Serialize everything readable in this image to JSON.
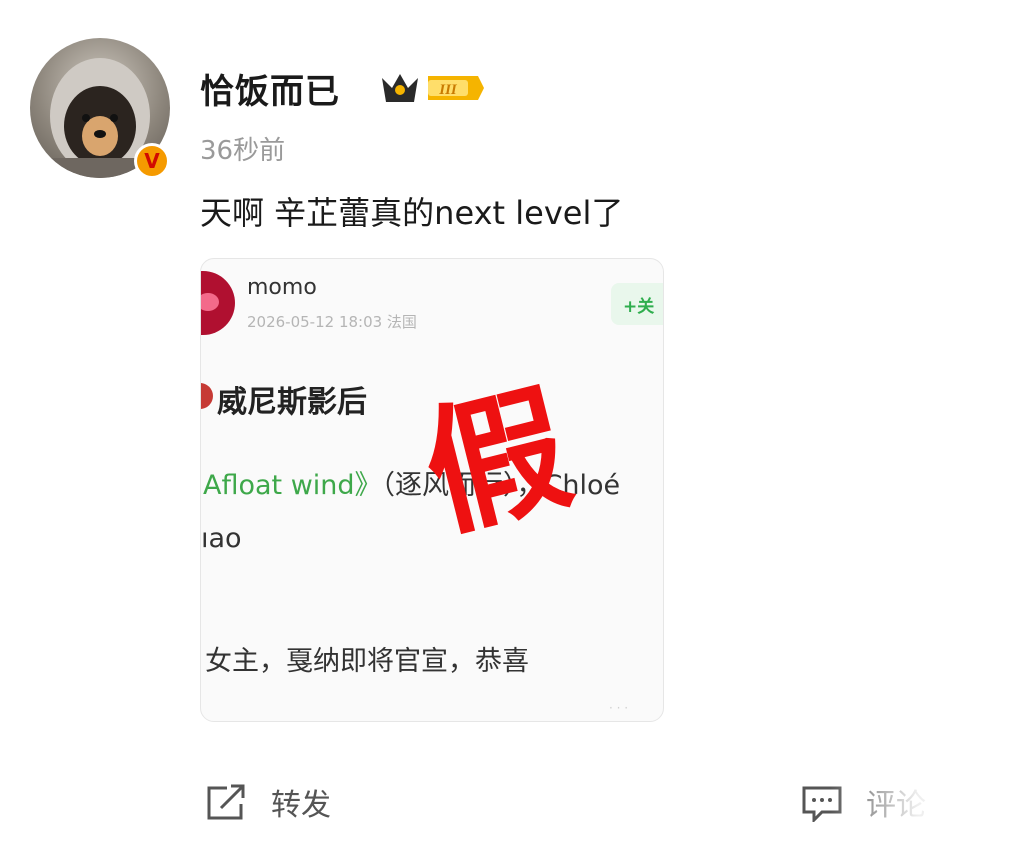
{
  "post": {
    "username": "恰饭而已",
    "vip_level": "III",
    "verified_badge": "V",
    "timestamp": "36秒前",
    "text": "天啊 辛芷蕾真的next level了"
  },
  "embed": {
    "name": "momo",
    "meta": "2026-05-12 18:03 法国",
    "follow_label": "+关",
    "title": "威尼斯影后",
    "line2_green": "Afloat wind》",
    "line2_rest": "（逐风而行），Chloé",
    "line3": "ıao",
    "line4": "女主，戛纳即将官宣，恭喜",
    "stamp": "假"
  },
  "actions": {
    "repost_label": "转发",
    "comment_label": "评论"
  },
  "colors": {
    "stamp_red": "#ee1111",
    "link_green": "#3ea84a",
    "vip_gold": "#f5b400"
  }
}
